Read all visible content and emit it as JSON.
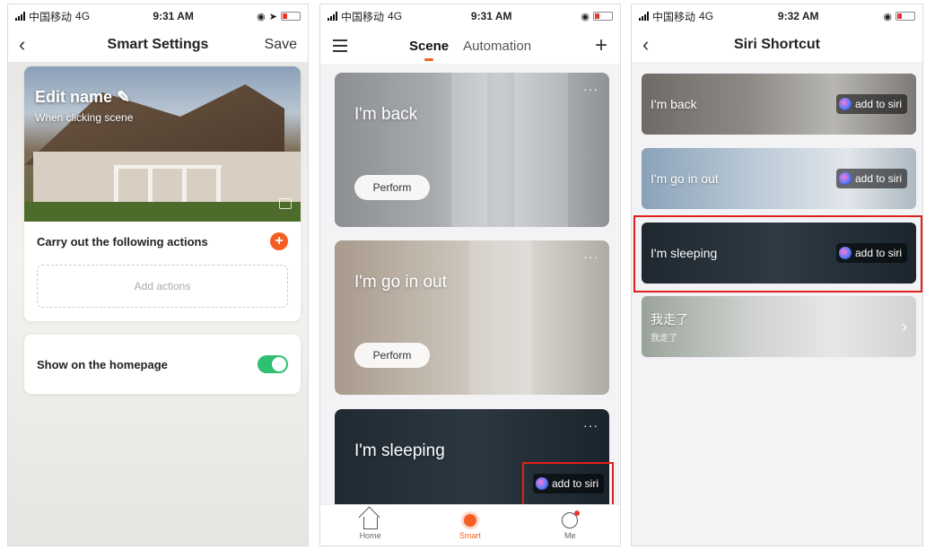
{
  "phones": [
    {
      "status": {
        "carrier": "中国移动",
        "network": "4G",
        "time": "9:31 AM"
      },
      "nav": {
        "back": "‹",
        "title": "Smart Settings",
        "save": "Save"
      },
      "hero": {
        "title": "Edit name",
        "subtitle": "When clicking  scene"
      },
      "actions": {
        "title": "Carry out the following actions",
        "add_placeholder": "Add actions"
      },
      "homepage": {
        "label": "Show on the homepage",
        "enabled": true
      }
    },
    {
      "status": {
        "carrier": "中国移动",
        "network": "4G",
        "time": "9:31 AM"
      },
      "tabs": [
        "Scene",
        "Automation"
      ],
      "scenes": [
        {
          "name": "I'm back",
          "button": "Perform"
        },
        {
          "name": "I'm go in out",
          "button": "Perform"
        },
        {
          "name": "I'm sleeping",
          "siri": "add to siri"
        }
      ],
      "tabbar": [
        "Home",
        "Smart",
        "Me"
      ]
    },
    {
      "status": {
        "carrier": "中国移动",
        "network": "4G",
        "time": "9:32 AM"
      },
      "nav": {
        "back": "‹",
        "title": "Siri Shortcut"
      },
      "shortcuts": [
        {
          "name": "I'm back",
          "siri": "add to siri"
        },
        {
          "name": "I'm go in out",
          "siri": "add to siri"
        },
        {
          "name": "I'm sleeping",
          "siri": "add to siri"
        },
        {
          "name": "我走了",
          "sub": "我走了"
        }
      ]
    }
  ],
  "colors": {
    "accent": "#f45e23",
    "toggle": "#2fbf71",
    "highlight": "#e0201c"
  }
}
